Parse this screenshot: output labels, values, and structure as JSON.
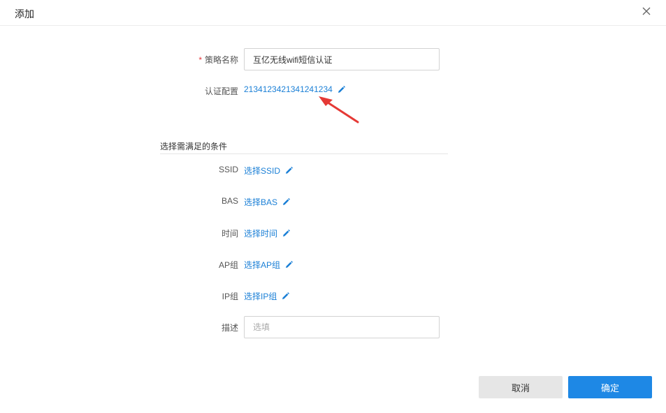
{
  "dialog": {
    "title": "添加",
    "close_icon": "close-icon"
  },
  "form": {
    "strategy_name": {
      "required_mark": "*",
      "label": "策略名称",
      "value": "互亿无线wifi短信认证"
    },
    "auth_config": {
      "label": "认证配置",
      "link_text": "2134123421341241234",
      "icon": "pencil-icon"
    },
    "conditions_section_title": "选择需满足的条件",
    "conditions": {
      "ssid": {
        "label": "SSID",
        "link_text": "选择SSID",
        "icon": "pencil-icon"
      },
      "bas": {
        "label": "BAS",
        "link_text": "选择BAS",
        "icon": "pencil-icon"
      },
      "time": {
        "label": "时间",
        "link_text": "选择时间",
        "icon": "pencil-icon"
      },
      "ap_group": {
        "label": "AP组",
        "link_text": "选择AP组",
        "icon": "pencil-icon"
      },
      "ip_group": {
        "label": "IP组",
        "link_text": "选择IP组",
        "icon": "pencil-icon"
      }
    },
    "description": {
      "label": "描述",
      "value": "",
      "placeholder": "选填"
    }
  },
  "footer": {
    "cancel_label": "取消",
    "ok_label": "确定"
  },
  "colors": {
    "link": "#1a7fd6",
    "primary_button": "#1e88e5",
    "cancel_button": "#e6e6e6",
    "required": "#e4393c",
    "annotation_arrow": "#e53935"
  }
}
